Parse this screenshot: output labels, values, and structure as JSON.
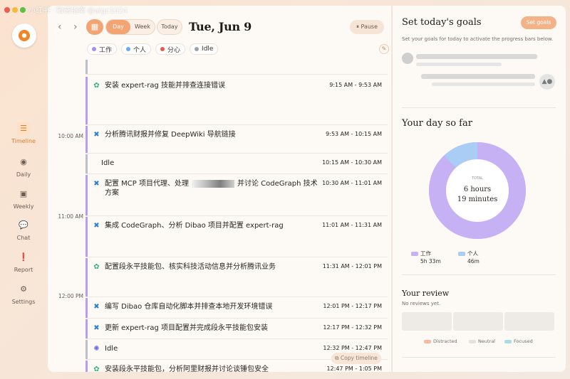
{
  "watermark": "小红书 · 敏感指南 @aigc1024",
  "sidebar": {
    "items": [
      {
        "label": "Timeline",
        "icon": "timeline-icon"
      },
      {
        "label": "Daily",
        "icon": "daily-icon"
      },
      {
        "label": "Weekly",
        "icon": "weekly-icon"
      },
      {
        "label": "Chat",
        "icon": "chat-icon"
      },
      {
        "label": "Report",
        "icon": "report-icon"
      },
      {
        "label": "Settings",
        "icon": "settings-icon"
      }
    ]
  },
  "toolbar": {
    "view_day": "Day",
    "view_week": "Week",
    "today": "Today",
    "date": "Tue, Jun 9",
    "pause": "⏸ Pause"
  },
  "categories": [
    {
      "label": "工作",
      "color": "#a78bf0"
    },
    {
      "label": "个人",
      "color": "#6fa8f0"
    },
    {
      "label": "分心",
      "color": "#e8594a"
    },
    {
      "label": "Idle",
      "color": "#9aa3b2"
    }
  ],
  "time_labels": [
    "10:00 AM",
    "11:00 AM",
    "12:00 PM"
  ],
  "timeline": [
    {
      "title": "安装 expert-rag 技能并排查连接错误",
      "time": "9:15 AM - 9:53 AM",
      "icon": "claude-icon"
    },
    {
      "title": "分析腾讯财报并修复 DeepWiki 导航链接",
      "time": "9:53 AM - 10:15 AM",
      "icon": "vscode-icon"
    },
    {
      "title": "Idle",
      "time": "10:15 AM - 10:30 AM",
      "icon": ""
    },
    {
      "title_a": "配置 MCP 项目代理、处理",
      "title_b": "并讨论 CodeGraph 技术方案",
      "time": "10:30 AM - 11:01 AM",
      "icon": "vscode-icon"
    },
    {
      "title": "集成 CodeGraph、分析 Dibao 项目并配置 expert-rag",
      "time": "11:01 AM - 11:31 AM",
      "icon": "vscode-icon"
    },
    {
      "title": "配置段永平技能包、核实科技活动信息并分析腾讯业务",
      "time": "11:31 AM - 12:01 PM",
      "icon": "claude-icon"
    },
    {
      "title": "编写 Dibao 仓库自动化脚本并排查本地开发环境错误",
      "time": "12:01 PM - 12:17 PM",
      "icon": "vscode-icon"
    },
    {
      "title": "更新 expert-rag 项目配置并完成段永平技能包安装",
      "time": "12:17 PM - 12:32 PM",
      "icon": "vscode-icon"
    },
    {
      "title": "Idle",
      "time": "12:32 PM - 12:47 PM",
      "icon": "idle-gear-icon"
    },
    {
      "title": "安装段永平技能包，分析阿里财报并讨论谈锤包安全",
      "time": "12:47 PM - 1:05 PM",
      "icon": "claude-icon"
    }
  ],
  "copy_timeline": "⧉ Copy timeline",
  "goals": {
    "title": "Set today's goals",
    "button": "Set goals",
    "subtitle": "Set your goals for today to activate the progress bars below."
  },
  "day_so_far": {
    "title": "Your day so far",
    "total_label": "TOTAL",
    "hours": "6 hours",
    "minutes": "19 minutes",
    "breakdown": [
      {
        "label": "工作",
        "value": "5h 33m",
        "minutes": 333,
        "color": "#c7b1f5"
      },
      {
        "label": "个人",
        "value": "46m",
        "minutes": 46,
        "color": "#a9cdf5"
      }
    ]
  },
  "review": {
    "title": "Your review",
    "subtitle": "No reviews yet.",
    "legend": [
      {
        "label": "Distracted",
        "color": "#f6b9a3"
      },
      {
        "label": "Neutral",
        "color": "#e6e1dc"
      },
      {
        "label": "Focused",
        "color": "#a9dde6"
      }
    ]
  }
}
